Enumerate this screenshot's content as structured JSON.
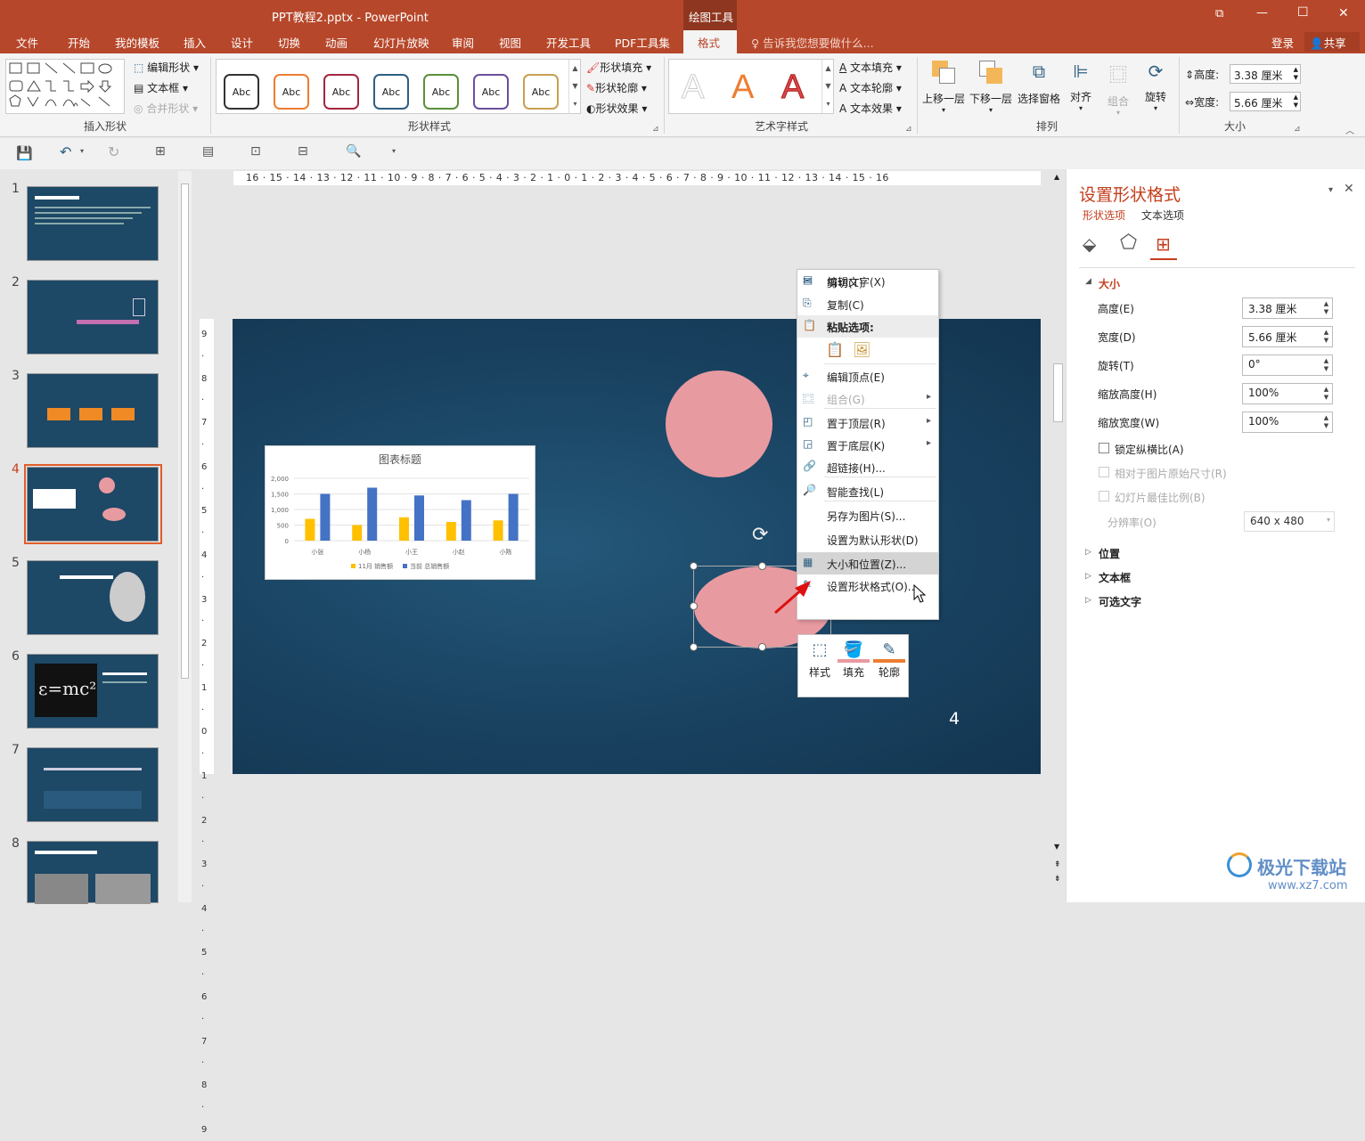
{
  "window": {
    "title": "PPT教程2.pptx - PowerPoint",
    "context_tab": "绘图工具",
    "controls": {
      "restore": "⧉",
      "minimize": "—",
      "maximize": "☐",
      "close": "✕"
    }
  },
  "menu": {
    "tabs": [
      "文件",
      "开始",
      "我的模板",
      "插入",
      "设计",
      "切换",
      "动画",
      "幻灯片放映",
      "审阅",
      "视图",
      "开发工具",
      "PDF工具集",
      "格式"
    ],
    "active": "格式",
    "tell_me": "告诉我您想要做什么...",
    "login": "登录",
    "share": "共享"
  },
  "ribbon": {
    "insert_shapes": {
      "label": "插入形状",
      "edit_shape": "编辑形状",
      "text_box": "文本框",
      "merge_shapes": "合并形状"
    },
    "shape_styles": {
      "label": "形状样式",
      "swatches": [
        "Abc",
        "Abc",
        "Abc",
        "Abc",
        "Abc",
        "Abc",
        "Abc"
      ],
      "swatch_colors": [
        "#222222",
        "#ed7d31",
        "#a5263f",
        "#2e5f82",
        "#5b8f3a",
        "#6b4f9e",
        "#c8a050"
      ],
      "fill": "形状填充",
      "outline": "形状轮廓",
      "effects": "形状效果"
    },
    "wordart": {
      "label": "艺术字样式",
      "letters": [
        "A",
        "A",
        "A"
      ],
      "text_fill": "文本填充",
      "text_outline": "文本轮廓",
      "text_effects": "文本效果"
    },
    "arrange": {
      "label": "排列",
      "bring_forward": "上移一层",
      "send_backward": "下移一层",
      "selection_pane": "选择窗格",
      "align": "对齐",
      "group": "组合",
      "rotate": "旋转"
    },
    "size": {
      "label": "大小",
      "height_label": "高度:",
      "height": "3.38 厘米",
      "width_label": "宽度:",
      "width": "5.66 厘米"
    }
  },
  "ruler": {
    "h_text": "16 · 15 · 14 · 13 · 12 · 11 · 10 · 9 · 8 · 7 · 6 · 5 · 4 · 3 · 2 · 1 · 0 · 1 · 2 · 3 · 4 · 5 · 6 · 7 · 8 · 9 · 10 · 11 · 12 · 13 · 14 · 15 · 16",
    "v_text": "9 · 8 · 7 · 6 · 5 · 4 · 3 · 2 · 1 · 0 · 1 · 2 · 3 · 4 · 5 · 6 · 7 · 8 · 9"
  },
  "thumbnails": {
    "numbers": [
      "1",
      "2",
      "3",
      "4",
      "5",
      "6",
      "7",
      "8"
    ],
    "selected": "4"
  },
  "slide": {
    "page_number": "4"
  },
  "chart_data": {
    "type": "bar",
    "title": "图表标题",
    "categories": [
      "小张",
      "小杨",
      "小王",
      "小赵",
      "小陈"
    ],
    "series": [
      {
        "name": "11月 销售额",
        "color": "#ffc000",
        "values": [
          700,
          500,
          750,
          600,
          650
        ]
      },
      {
        "name": "当前 总销售额",
        "color": "#4472c4",
        "values": [
          1500,
          1700,
          1450,
          1300,
          1500
        ]
      }
    ],
    "yticks": [
      "2,000",
      "1,500",
      "1,000",
      "500",
      "0"
    ],
    "ylim": [
      0,
      2000
    ],
    "legend_position": "bottom"
  },
  "context_menu": {
    "items": [
      {
        "label": "剪切(T)",
        "icon": "scissors-icon",
        "disabled": false
      },
      {
        "label": "复制(C)",
        "icon": "copy-icon",
        "disabled": false
      },
      {
        "label": "粘贴选项:",
        "icon": "paste-icon",
        "disabled": false,
        "header": true
      },
      {
        "label": "编辑文字(X)",
        "icon": "edit-text-icon",
        "disabled": false
      },
      {
        "label": "编辑顶点(E)",
        "icon": "edit-points-icon",
        "disabled": false
      },
      {
        "label": "组合(G)",
        "icon": "group-icon",
        "disabled": true,
        "submenu": true
      },
      {
        "label": "置于顶层(R)",
        "icon": "bring-front-icon",
        "disabled": false,
        "submenu": true
      },
      {
        "label": "置于底层(K)",
        "icon": "send-back-icon",
        "disabled": false,
        "submenu": true
      },
      {
        "label": "超链接(H)...",
        "icon": "hyperlink-icon",
        "disabled": false
      },
      {
        "label": "智能查找(L)",
        "icon": "smart-lookup-icon",
        "disabled": false
      },
      {
        "label": "另存为图片(S)...",
        "icon": "",
        "disabled": false
      },
      {
        "label": "设置为默认形状(D)",
        "icon": "",
        "disabled": false
      },
      {
        "label": "大小和位置(Z)...",
        "icon": "size-position-icon",
        "disabled": false,
        "highlighted": true
      },
      {
        "label": "设置形状格式(O)...",
        "icon": "format-shape-icon",
        "disabled": false
      }
    ]
  },
  "mini_toolbar": {
    "style": "样式",
    "fill": "填充",
    "outline": "轮廓"
  },
  "pane": {
    "title": "设置形状格式",
    "tab_shape": "形状选项",
    "tab_text": "文本选项",
    "section_size": "大小",
    "fields": [
      {
        "label": "高度(E)",
        "value": "3.38 厘米"
      },
      {
        "label": "宽度(D)",
        "value": "5.66 厘米"
      },
      {
        "label": "旋转(T)",
        "value": "0°"
      },
      {
        "label": "缩放高度(H)",
        "value": "100%"
      },
      {
        "label": "缩放宽度(W)",
        "value": "100%"
      }
    ],
    "lock_ratio": "锁定纵横比(A)",
    "relative_original": "相对于图片原始尺寸(R)",
    "best_scale": "幻灯片最佳比例(B)",
    "resolution_label": "分辨率(O)",
    "resolution": "640 x 480",
    "section_position": "位置",
    "section_textbox": "文本框",
    "section_alt": "可选文字"
  },
  "watermark": {
    "brand": "极光下载站",
    "url": "www.xz7.com"
  }
}
